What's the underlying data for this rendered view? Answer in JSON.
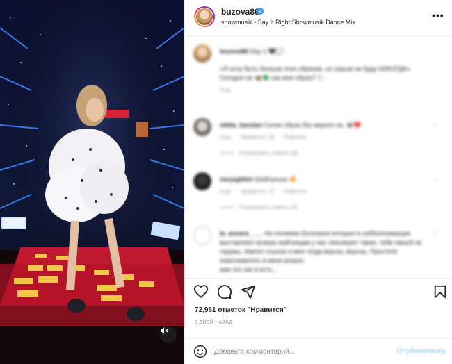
{
  "post": {
    "username": "buzova86",
    "audio": "showmusik • Say It Right Showmusik Dance Mix",
    "more_label": "•••"
  },
  "comments": [
    {
      "username": "buzova86",
      "text": "Day 1 🖤💭",
      "text2": "«Я хочу быть больше этих образов, но серым не буду НИКОГДА»",
      "text3": "Сегодня на 🦋🦚 как мне образ? 🐑",
      "meta": [
        "3 дн."
      ]
    },
    {
      "username": "nikita_baroian",
      "text": "Селин образ без верхоп ов. 😭❤️",
      "meta": [
        "3 дн.",
        "Нравится: 18",
        "Ответить"
      ],
      "replies": "Посмотреть ответы (8)"
    },
    {
      "username": "varyagbbm",
      "text": "Шаблунька 🔥",
      "meta": [
        "3 дн.",
        "Нравится: 17",
        "Ответить"
      ],
      "replies": "Посмотреть ответы (4)"
    },
    {
      "username": "la_ansara____",
      "text": "Не понимаю Бозонров которые в zаббы/комерции выставляют всякую жуйгинцам у нас лексикуют такие, тебе смысй не горумы. Хватит ссылок и мне тогда вкусно, вкусны. Простите комплиметить в меня вопрос",
      "text2": "вам это как в есть..."
    }
  ],
  "actions": {
    "like_icon": "heart-icon",
    "comment_icon": "comment-icon",
    "share_icon": "share-icon",
    "save_icon": "bookmark-icon"
  },
  "likes_text": "72,961 отметок \"Нравится\"",
  "time_ago": "3 ДНЕЙ НАЗАД",
  "composer": {
    "placeholder": "Добавьте комментарий...",
    "post_label": "Опубликовать"
  },
  "colors": {
    "accent": "#0095f6",
    "post_disabled": "#b2dffc",
    "verified": "#3897f0"
  }
}
